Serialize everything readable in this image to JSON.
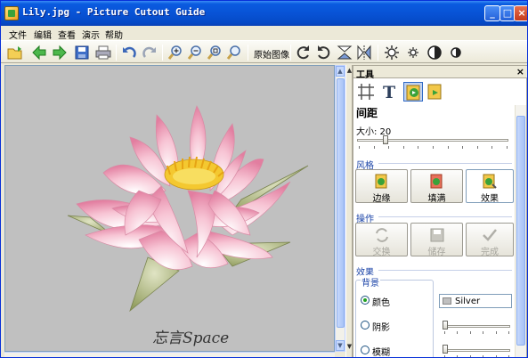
{
  "window": {
    "title": "Lily.jpg - Picture Cutout Guide"
  },
  "menu": {
    "items": [
      "文件",
      "编辑",
      "查看",
      "演示",
      "帮助"
    ]
  },
  "toolbar": {
    "original_image_label": "原始图像"
  },
  "canvas": {
    "caption": "忘言Space",
    "background_color": "#c0c0c0"
  },
  "panel": {
    "title": "工具",
    "spacing": {
      "title": "间距",
      "size_label": "大小: 20",
      "size_value": 20
    },
    "style": {
      "title": "风格",
      "buttons": [
        "边缘",
        "填满",
        "效果"
      ],
      "active": "效果"
    },
    "operation": {
      "title": "操作",
      "buttons": [
        "交换",
        "储存",
        "完成"
      ]
    },
    "effects": {
      "title": "效果",
      "background": {
        "title": "背景",
        "options": [
          "颜色",
          "阴影",
          "模糊"
        ],
        "selected": "颜色",
        "color_value": "Silver"
      }
    }
  }
}
